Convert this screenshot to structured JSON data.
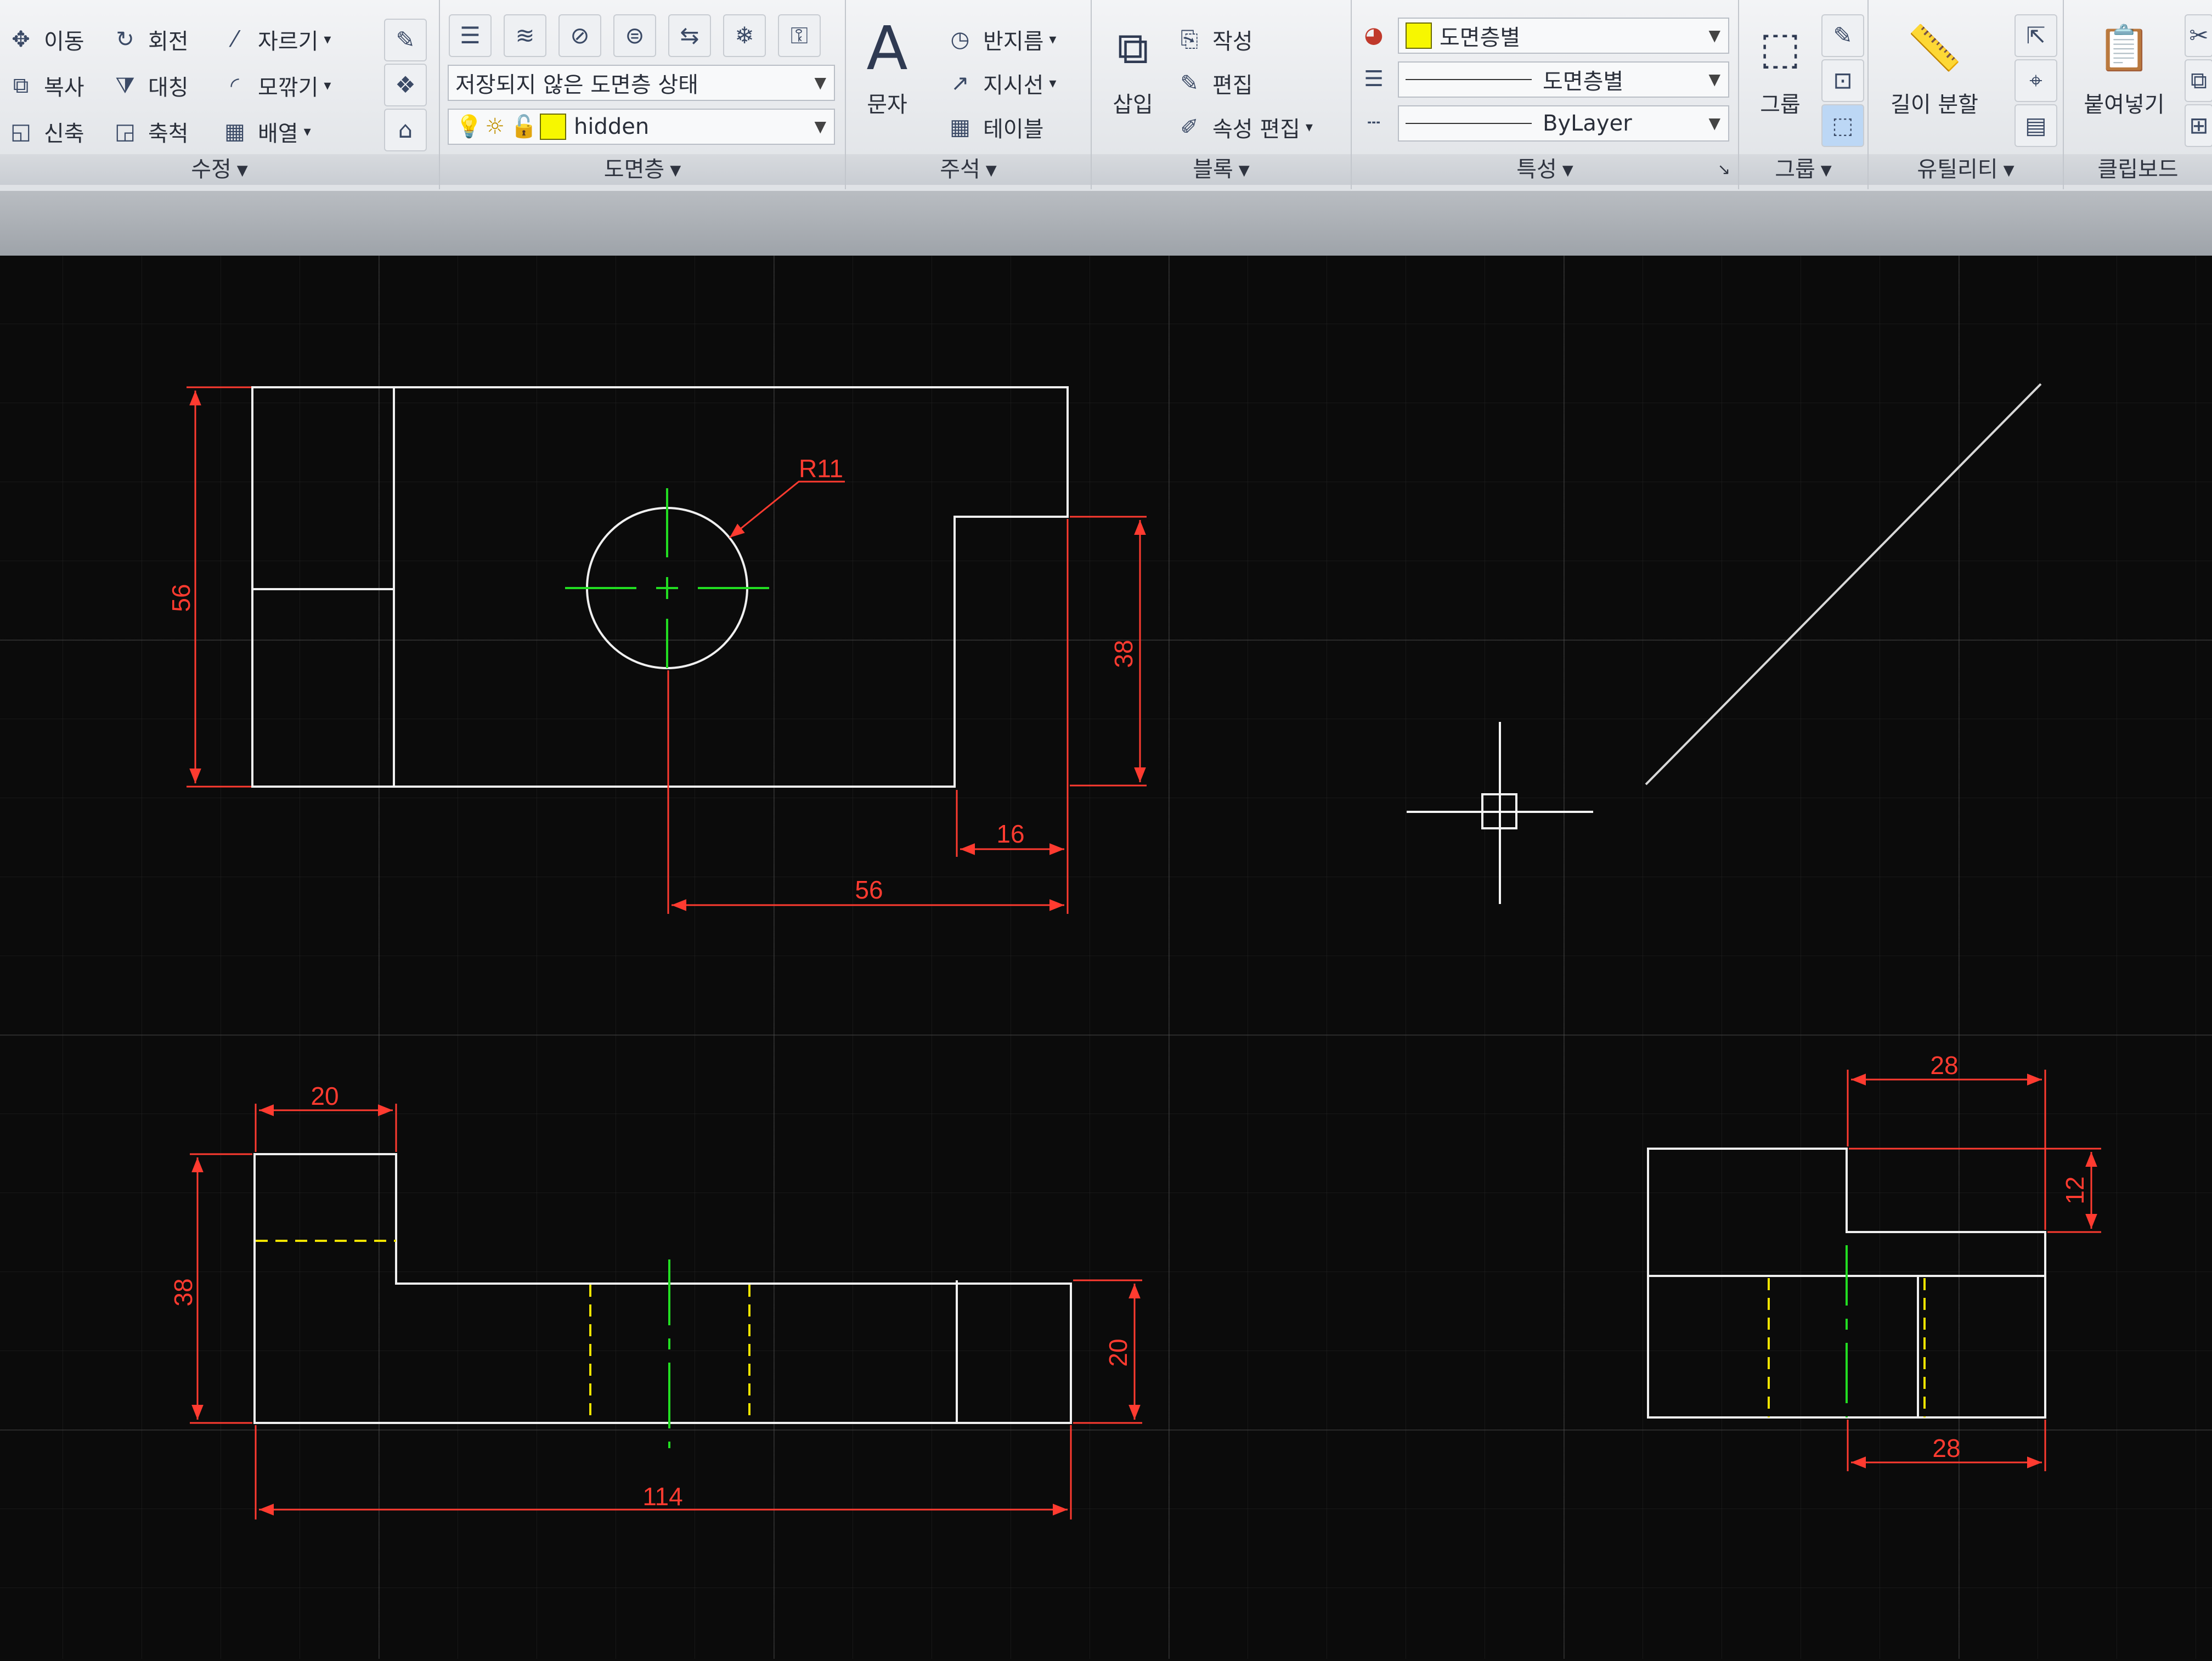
{
  "ribbon": {
    "modify": {
      "title": "수정",
      "items": [
        "이동",
        "회전",
        "자르기",
        "복사",
        "대칭",
        "모깎기",
        "신축",
        "축척",
        "배열"
      ]
    },
    "layers": {
      "title": "도면층",
      "state_combo": "저장되지 않은 도면층 상태",
      "layer_combo": "hidden"
    },
    "annotation": {
      "title": "주석",
      "text_label": "문자",
      "items": [
        "반지름",
        "지시선",
        "테이블"
      ]
    },
    "block": {
      "title": "블록",
      "insert_label": "삽입",
      "items": [
        "작성",
        "편집",
        "속성 편집"
      ]
    },
    "properties": {
      "title": "특성",
      "color_combo": "도면층별",
      "lineweight_combo": "도면층별",
      "linetype_combo": "ByLayer"
    },
    "groups": {
      "title": "그룹",
      "group_label": "그룹"
    },
    "utilities": {
      "title": "유틸리티",
      "measure_label": "길이 분할"
    },
    "clipboard": {
      "title": "클립보드",
      "paste_label": "붙여넣기"
    }
  },
  "drawing": {
    "front_view": {
      "dims": [
        "56",
        "R11",
        "38",
        "16",
        "56"
      ]
    },
    "top_view": {
      "dims": [
        "20",
        "38",
        "20",
        "114"
      ]
    },
    "side_view": {
      "dims": [
        "28",
        "12",
        "28"
      ]
    }
  },
  "colors": {
    "dimension": "#ff3b30",
    "object_line": "#f0f0f0",
    "center_line": "#22dd22",
    "hidden_line": "#f2e400",
    "layer_swatch": "#f7f700"
  }
}
